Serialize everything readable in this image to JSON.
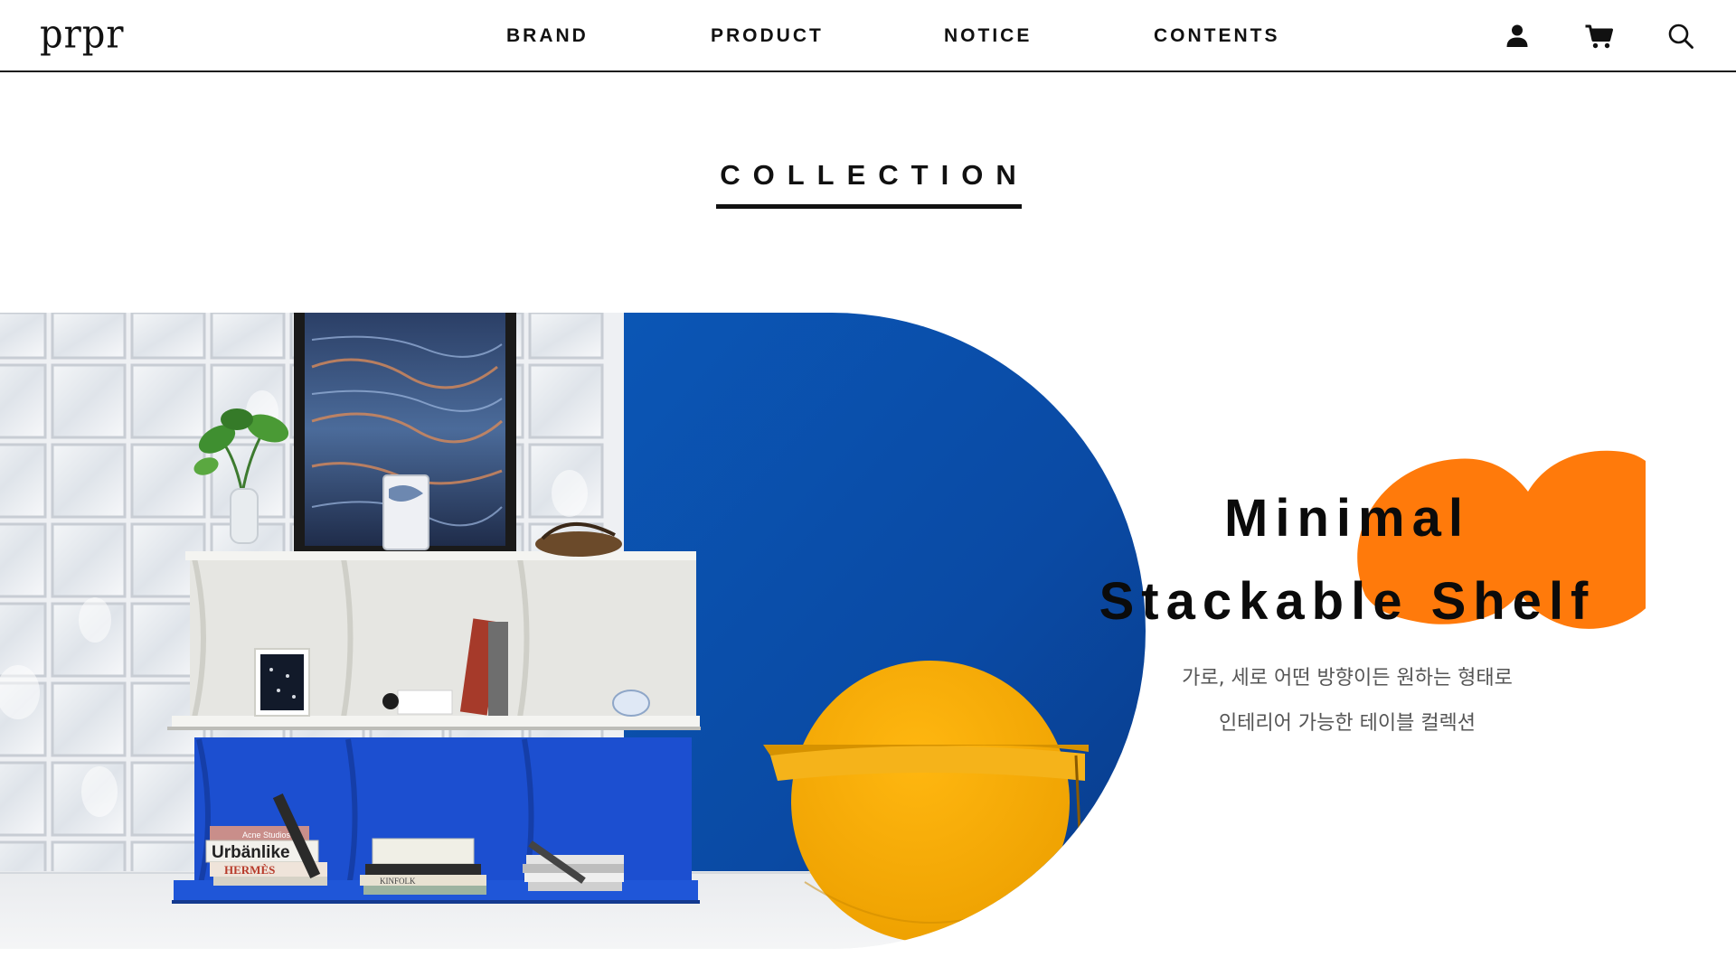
{
  "header": {
    "logo": "prpr",
    "nav": [
      "BRAND",
      "PRODUCT",
      "NOTICE",
      "CONTENTS"
    ],
    "icons": [
      "user-icon",
      "cart-icon",
      "search-icon"
    ]
  },
  "section": {
    "title": "COLLECTION"
  },
  "hero": {
    "headline_line1": "Minimal",
    "headline_line2": "Stackable Shelf",
    "desc_line1": "가로, 세로 어떤 방향이든 원하는 형태로",
    "desc_line2": "인테리어 가능한 테이블 컬렉션",
    "image_text": {
      "book1": "Acne Studios",
      "book2": "Urbänlike",
      "book3": "HERMÈS",
      "book4": "KINFOLK"
    }
  },
  "colors": {
    "accent_orange": "#FF7A0B",
    "wall_blue": "#0A4BA8",
    "shelf_yellow": "#F2A900",
    "text_dark": "#111111"
  }
}
